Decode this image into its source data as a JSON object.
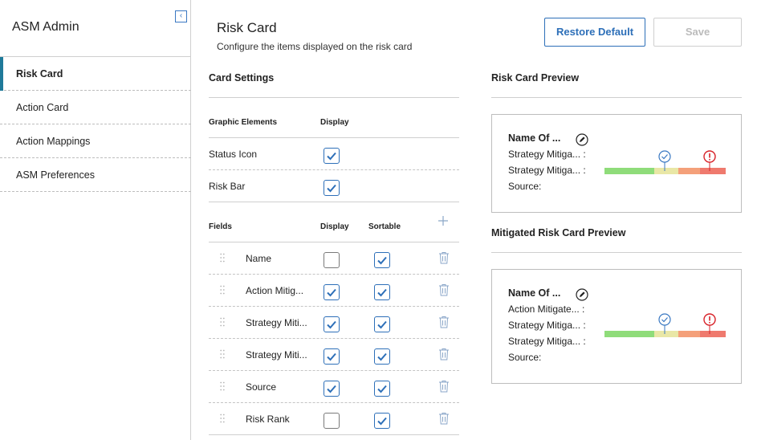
{
  "sidebar": {
    "title": "ASM Admin",
    "collapse_glyph": "‹",
    "items": [
      {
        "label": "Risk Card",
        "active": true
      },
      {
        "label": "Action Card",
        "active": false
      },
      {
        "label": "Action Mappings",
        "active": false
      },
      {
        "label": "ASM Preferences",
        "active": false
      }
    ]
  },
  "header": {
    "title": "Risk Card",
    "subtitle": "Configure the items displayed on the risk card",
    "restore_label": "Restore Default",
    "save_label": "Save"
  },
  "settings": {
    "title": "Card Settings",
    "graphic_header": "Graphic Elements",
    "display_header": "Display",
    "graphic_rows": [
      {
        "label": "Status Icon",
        "display": true
      },
      {
        "label": "Risk Bar",
        "display": true
      }
    ],
    "fields_header": "Fields",
    "fields_display_header": "Display",
    "fields_sortable_header": "Sortable",
    "field_rows": [
      {
        "label": "Name",
        "display": false,
        "sortable": true
      },
      {
        "label": "Action Mitig...",
        "display": true,
        "sortable": true
      },
      {
        "label": "Strategy Miti...",
        "display": true,
        "sortable": true
      },
      {
        "label": "Strategy Miti...",
        "display": true,
        "sortable": true
      },
      {
        "label": "Source",
        "display": true,
        "sortable": true
      },
      {
        "label": "Risk Rank",
        "display": false,
        "sortable": true
      }
    ]
  },
  "preview": {
    "title": "Risk Card Preview",
    "name": "Name Of ...",
    "lines": [
      "Strategy Mitiga... :",
      "Strategy Mitiga... :",
      "Source:"
    ]
  },
  "mitigated_preview": {
    "title": "Mitigated Risk Card Preview",
    "name": "Name Of ...",
    "lines": [
      "Action Mitigate... :",
      "Strategy Mitiga... :",
      "Strategy Mitiga... :",
      "Source:"
    ]
  },
  "colors": {
    "accent": "#2d6fb8",
    "active_bar": "#1f7a9a",
    "risk_green": "#8fdc7a",
    "risk_yellow": "#e9e7a6",
    "risk_orange": "#f4a07a",
    "risk_red": "#ef7a6e",
    "alert_red": "#d8232a"
  },
  "icons": {
    "collapse": "chevron-left-icon",
    "add": "plus-icon",
    "delete": "trash-icon",
    "drag": "drag-handle-icon",
    "edit": "pencil-icon",
    "mitigated": "check-circle-icon",
    "unmitigated": "exclamation-circle-icon"
  }
}
